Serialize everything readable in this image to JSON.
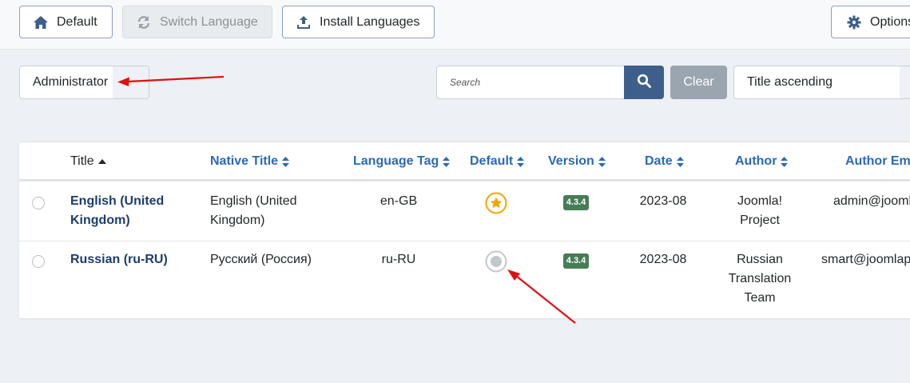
{
  "toolbar": {
    "default_label": "Default",
    "switch_label": "Switch Language",
    "install_label": "Install Languages",
    "options_label": "Options"
  },
  "filters": {
    "client_value": "Administrator",
    "search_placeholder": "Search",
    "clear_label": "Clear",
    "sort_value": "Title ascending"
  },
  "table": {
    "headers": {
      "title": "Title",
      "native_title": "Native Title",
      "language_tag": "Language Tag",
      "default": "Default",
      "version": "Version",
      "date": "Date",
      "author": "Author",
      "author_email": "Author Email"
    },
    "rows": [
      {
        "title_line1": "English (United",
        "title_line2": "Kingdom)",
        "native_line1": "English (United",
        "native_line2": "Kingdom)",
        "tag": "en-GB",
        "default": "star",
        "version": "4.3.4",
        "date": "2023-08",
        "author_line1": "Joomla!",
        "author_line2": "Project",
        "email": "admin@joomla.org"
      },
      {
        "title_line1": "Russian (ru-RU)",
        "native_line1": "Русский (Россия)",
        "tag": "ru-RU",
        "default": "circle",
        "version": "4.3.4",
        "date": "2023-08",
        "author_line1": "Russian",
        "author_line2": "Translation",
        "author_line3": "Team",
        "email": "smart@joomlaportal.ru"
      }
    ]
  },
  "colors": {
    "link": "#2a69b8",
    "primary": "#3e5f8c",
    "badge": "#457d54",
    "star": "#f0a500",
    "annotation": "#e01010"
  },
  "icons": {
    "default_button": "home-icon",
    "switch_button": "sync-icon",
    "install_button": "upload-icon",
    "options_button": "gear-icon",
    "search_button": "search-icon",
    "default_star": "star-icon",
    "default_unset": "circle-icon"
  }
}
